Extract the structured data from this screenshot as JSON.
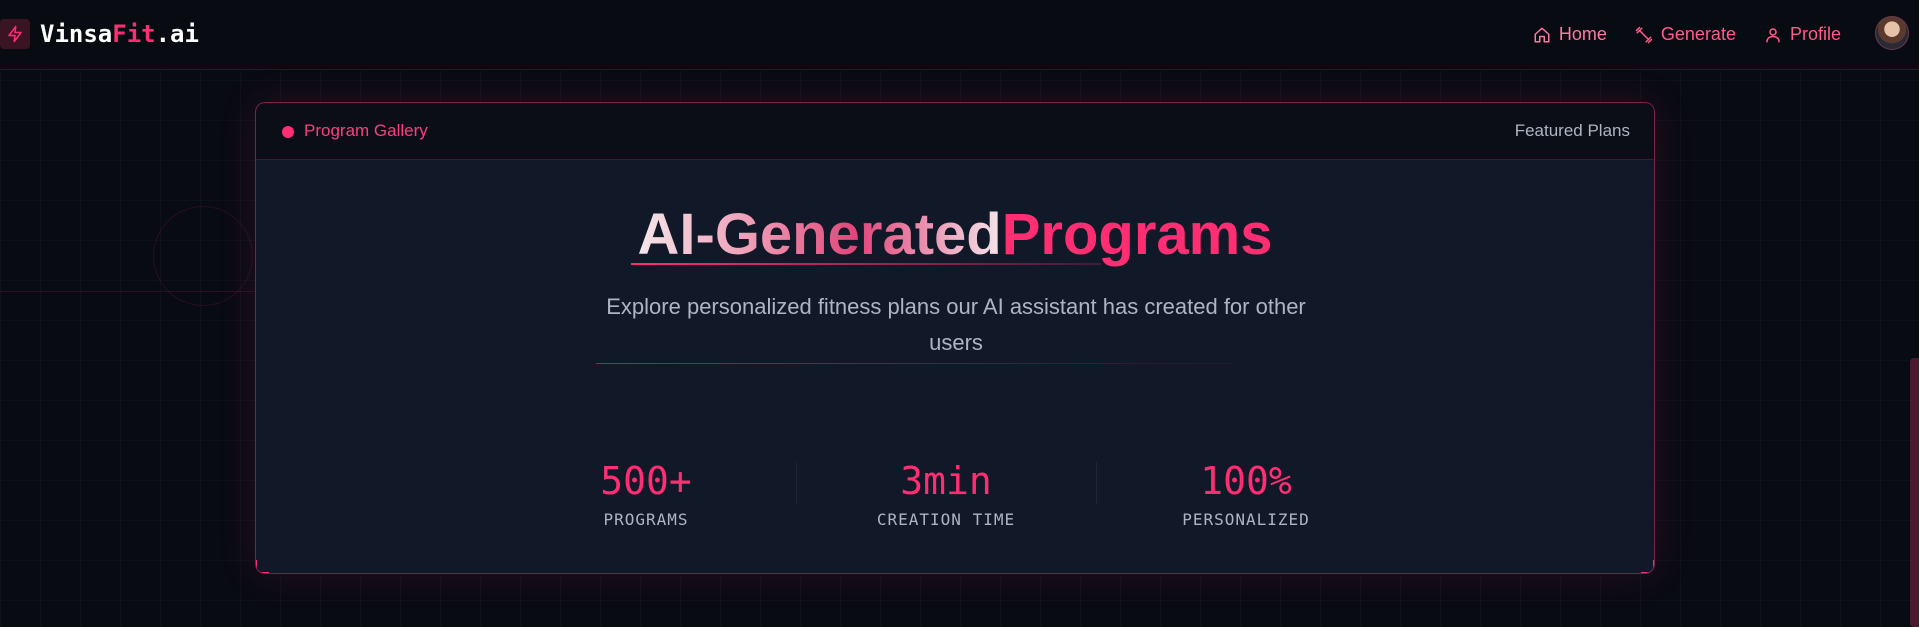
{
  "app": {
    "logo": {
      "prefix": "Vinsa",
      "accent": "Fit",
      "suffix": ".ai",
      "icon": "bolt-icon"
    }
  },
  "nav": {
    "items": [
      {
        "label": "Home",
        "icon": "home-icon"
      },
      {
        "label": "Generate",
        "icon": "dumbbell-icon"
      },
      {
        "label": "Profile",
        "icon": "user-icon"
      }
    ],
    "avatar": "user-avatar"
  },
  "card": {
    "header_title": "Program Gallery",
    "header_right": "Featured Plans",
    "title_part1": "AI-Generated",
    "title_part2": "Programs",
    "subtitle": "Explore personalized fitness plans our AI assistant has created for other users",
    "stats": [
      {
        "value": "500+",
        "label": "PROGRAMS"
      },
      {
        "value": "3min",
        "label": "CREATION TIME"
      },
      {
        "value": "100%",
        "label": "PERSONALIZED"
      }
    ]
  },
  "colors": {
    "accent": "#ff2e73",
    "background": "#090b12",
    "card": "#111827",
    "muted_text": "#aeb4c2"
  }
}
